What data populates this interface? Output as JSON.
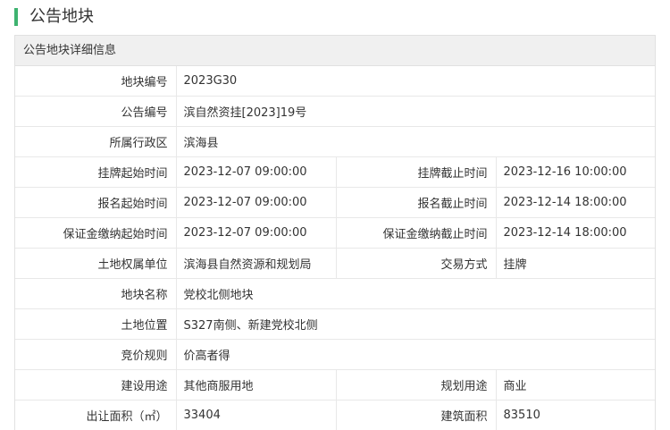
{
  "header": {
    "title": "公告地块"
  },
  "panel": {
    "title": "公告地块详细信息"
  },
  "fields": {
    "plot_no": {
      "label": "地块编号",
      "value": "2023G30"
    },
    "notice_no": {
      "label": "公告编号",
      "value": "滨自然资挂[2023]19号"
    },
    "district": {
      "label": "所属行政区",
      "value": "滨海县"
    },
    "listing_start": {
      "label": "挂牌起始时间",
      "value": "2023-12-07 09:00:00"
    },
    "listing_end": {
      "label": "挂牌截止时间",
      "value": "2023-12-16 10:00:00"
    },
    "signup_start": {
      "label": "报名起始时间",
      "value": "2023-12-07 09:00:00"
    },
    "signup_end": {
      "label": "报名截止时间",
      "value": "2023-12-14 18:00:00"
    },
    "deposit_start": {
      "label": "保证金缴纳起始时间",
      "value": "2023-12-07 09:00:00"
    },
    "deposit_end": {
      "label": "保证金缴纳截止时间",
      "value": "2023-12-14 18:00:00"
    },
    "owner": {
      "label": "土地权属单位",
      "value": "滨海县自然资源和规划局"
    },
    "trade_method": {
      "label": "交易方式",
      "value": "挂牌"
    },
    "plot_name": {
      "label": "地块名称",
      "value": "党校北侧地块"
    },
    "location": {
      "label": "土地位置",
      "value": "S327南侧、新建党校北侧"
    },
    "bid_rule": {
      "label": "竞价规则",
      "value": "价高者得"
    },
    "build_use": {
      "label": "建设用途",
      "value": "其他商服用地"
    },
    "plan_use": {
      "label": "规划用途",
      "value": "商业"
    },
    "area": {
      "label": "出让面积（㎡）",
      "value": "33404"
    },
    "build_area": {
      "label": "建筑面积",
      "value": "83510"
    }
  }
}
